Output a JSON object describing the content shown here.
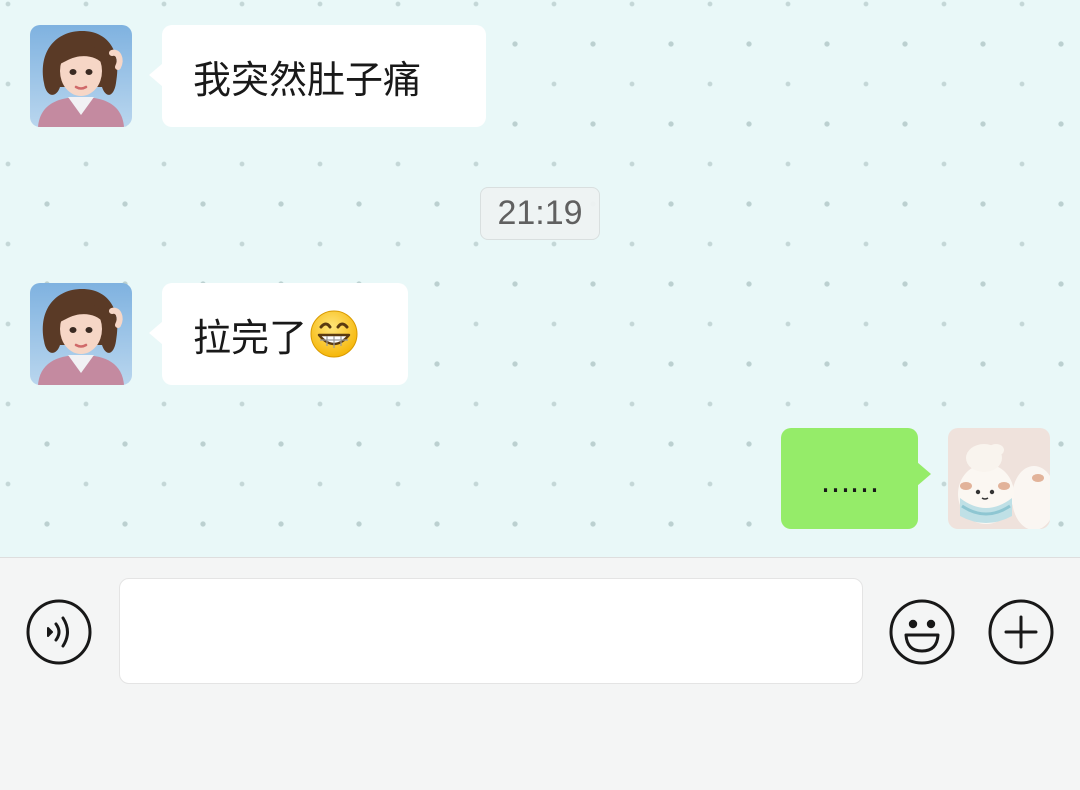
{
  "chat": {
    "messages": [
      {
        "side": "left",
        "text": "我突然肚子痛"
      },
      {
        "side": "left",
        "text": "拉完了",
        "emoji": "grinning-face-emoji"
      },
      {
        "side": "right",
        "text": "……"
      }
    ],
    "timestamp": "21:19"
  },
  "input_bar": {
    "input_value": "",
    "icons": [
      "voice-icon",
      "emoji-icon",
      "plus-icon"
    ]
  },
  "colors": {
    "chat_background": "#e9f8f8",
    "incoming_bubble": "#ffffff",
    "outgoing_bubble": "#95ec69",
    "input_bar_background": "#f4f5f5"
  }
}
